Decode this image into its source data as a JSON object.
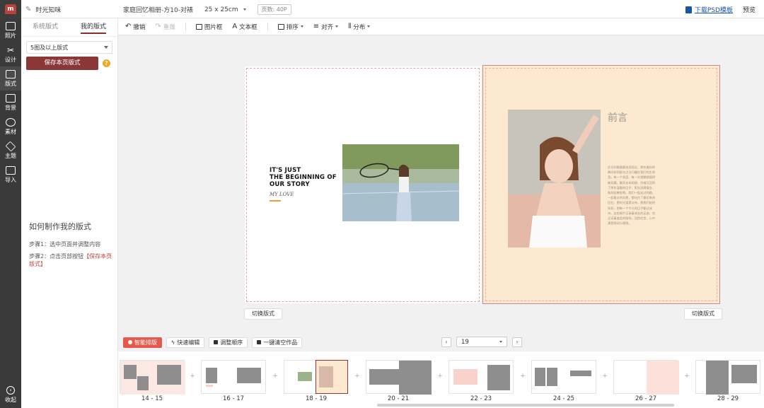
{
  "app": {
    "project_name": "时光知味",
    "doc_title": "家庭回忆相册-方10-对裱",
    "size": "25 x 25cm",
    "page_count": "页数: 40P",
    "download_psd": "下载PSD模板",
    "preview": "预览"
  },
  "rail": {
    "items": [
      {
        "label": "照片",
        "icon": "photo-icon"
      },
      {
        "label": "设计",
        "icon": "tools-icon"
      },
      {
        "label": "版式",
        "icon": "layout-icon"
      },
      {
        "label": "背景",
        "icon": "background-icon"
      },
      {
        "label": "素材",
        "icon": "material-icon"
      },
      {
        "label": "主题",
        "icon": "layers-icon"
      },
      {
        "label": "导入",
        "icon": "import-icon"
      }
    ],
    "collapse": "收起"
  },
  "panel": {
    "tab_system": "系统版式",
    "tab_mine": "我的版式",
    "filter": "5图及以上版式",
    "save_button": "保存本页版式",
    "help": "?",
    "howto_title": "如何制作我的版式",
    "step1": "步骤1：选中页面并调整内容",
    "step2_prefix": "步骤2：点击页部按钮",
    "step2_highlight": "【保存本页版式】"
  },
  "toolbar": {
    "undo": "撤销",
    "redo": "重做",
    "image_frame": "图片框",
    "text_frame": "文本框",
    "arrange": "排序",
    "align": "对齐",
    "distribute": "分布"
  },
  "canvas": {
    "story_line1": "IT'S JUST",
    "story_line2": "THE BEGINNING OF",
    "story_line3": "OUR STORY",
    "story_sub": "MY LOVE",
    "preface_title": "前言",
    "preface_text": "岁月如歌静静流淌而过，那些美好的瞬间如同星光点点闪耀在我们的生命里。每一个笑容、每一次相聚都值得被珍藏。翻开这本相册，仿佛又回到了那些温暖的日子，阳光洒满窗台，微风轻拂发梢。我们一起走过的路，一起看过的风景，都化作了最珍贵的回忆。愿时光温柔以待，愿我们始终如初，把每一个平凡的日子都过成诗。这些照片记录着成长的足迹，也见证着彼此的陪伴。回首往昔，心中满是感动与感恩。",
    "switch_left": "切换版式",
    "switch_right": "切换版式"
  },
  "bottombar": {
    "smart": "智能排版",
    "quick_edit": "快速编辑",
    "reorder": "调整顺序",
    "clear": "一键清空作品",
    "current_page": "19"
  },
  "thumbnails": [
    {
      "label": "14 - 15"
    },
    {
      "label": "16 - 17"
    },
    {
      "label": "18 - 19"
    },
    {
      "label": "20 - 21"
    },
    {
      "label": "22 - 23"
    },
    {
      "label": "24 - 25"
    },
    {
      "label": "26 - 27"
    },
    {
      "label": "28 - 29"
    }
  ],
  "colors": {
    "accent": "#8b3737",
    "primary_button": "#e65a4c",
    "page_right_bg": "#fde9cf",
    "rail_bg": "#3a3a3a",
    "highlight": "#b9433c"
  }
}
